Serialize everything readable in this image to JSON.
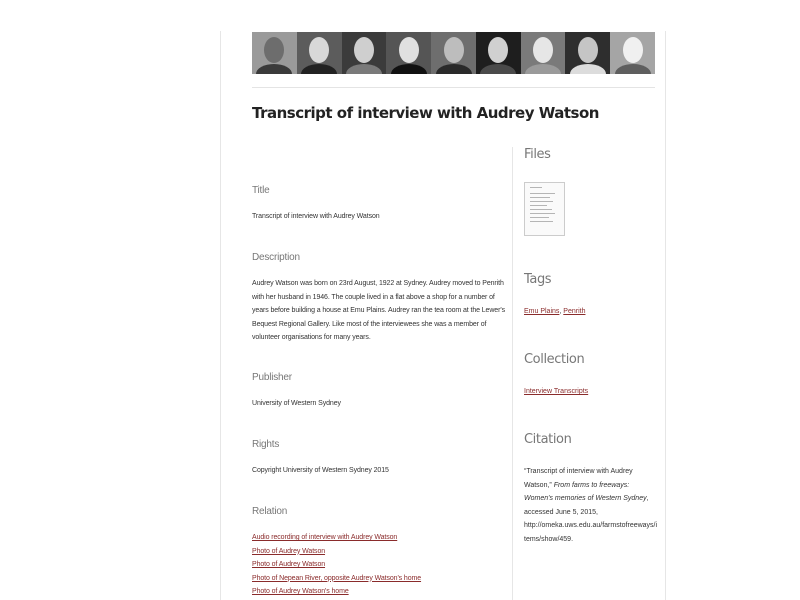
{
  "item": {
    "title": "Transcript of interview with Audrey Watson"
  },
  "banner": {
    "portraits": [
      {
        "face": "#6d6d6d",
        "body": "#3a3a3a",
        "bg": "#9a9a9a"
      },
      {
        "face": "#d8d8d8",
        "body": "#222222",
        "bg": "#5c5c5c"
      },
      {
        "face": "#cfcfcf",
        "body": "#7a7a7a",
        "bg": "#3b3b3b"
      },
      {
        "face": "#e0e0e0",
        "body": "#111111",
        "bg": "#555555"
      },
      {
        "face": "#bdbdbd",
        "body": "#2a2a2a",
        "bg": "#6e6e6e"
      },
      {
        "face": "#d0d0d0",
        "body": "#4a4a4a",
        "bg": "#1e1e1e"
      },
      {
        "face": "#e6e6e6",
        "body": "#9a9a9a",
        "bg": "#7a7a7a"
      },
      {
        "face": "#c5c5c5",
        "body": "#dcdcdc",
        "bg": "#2e2e2e"
      },
      {
        "face": "#f0f0f0",
        "body": "#5e5e5e",
        "bg": "#a5a5a5"
      }
    ]
  },
  "fields": {
    "title": {
      "label": "Title",
      "value": "Transcript of interview with Audrey Watson"
    },
    "description": {
      "label": "Description",
      "value": "Audrey Watson was born on 23rd August, 1922 at Sydney. Audrey moved to Penrith with her husband in 1946. The couple lived in a flat above a shop for a number of years before building a house at Emu Plains. Audrey ran the tea room at the Lewer's Bequest Regional Gallery. Like most of the interviewees she was a member of volunteer organisations for many years."
    },
    "publisher": {
      "label": "Publisher",
      "value": "University of Western Sydney"
    },
    "rights": {
      "label": "Rights",
      "value": "Copyright University of Western Sydney 2015"
    },
    "relation": {
      "label": "Relation",
      "links": [
        "Audio recording of interview with Audrey Watson",
        "Photo of Audrey Watson",
        "Photo of Audrey Watson",
        "Photo of Nepean River, opposite Audrey Watson's home",
        "Photo of Audrey Watson's home"
      ]
    }
  },
  "sidebar": {
    "files": {
      "heading": "Files"
    },
    "tags": {
      "heading": "Tags",
      "items": [
        "Emu Plains",
        "Penrith"
      ],
      "separator": ", "
    },
    "collection": {
      "heading": "Collection",
      "link": "Interview Transcripts"
    },
    "citation": {
      "heading": "Citation",
      "part1": "“Transcript of interview with Audrey Watson,” ",
      "site": "From farms to freeways: Women's memories of Western Sydney",
      "part2": ", accessed June 5, 2015, http://omeka.uws.edu.au/farmstofreeways/items/show/459."
    }
  },
  "colors": {
    "link": "#8a2b2b",
    "label": "#777777",
    "text": "#333333"
  }
}
